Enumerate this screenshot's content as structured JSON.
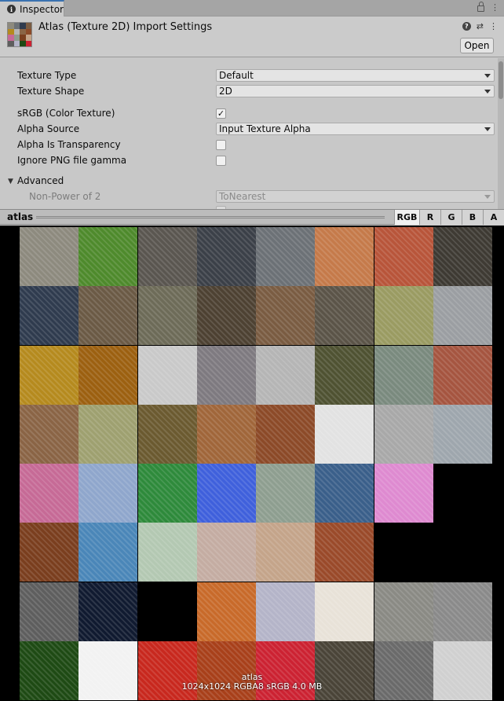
{
  "tab": {
    "label": "Inspector"
  },
  "header": {
    "title": "Atlas (Texture 2D) Import Settings",
    "open_label": "Open"
  },
  "props": {
    "texture_type": {
      "label": "Texture Type",
      "value": "Default"
    },
    "texture_shape": {
      "label": "Texture Shape",
      "value": "2D"
    },
    "srgb": {
      "label": "sRGB (Color Texture)",
      "checked": "✓"
    },
    "alpha_source": {
      "label": "Alpha Source",
      "value": "Input Texture Alpha"
    },
    "alpha_is_transparency": {
      "label": "Alpha Is Transparency"
    },
    "ignore_png_gamma": {
      "label": "Ignore PNG file gamma"
    },
    "advanced": {
      "label": "Advanced"
    },
    "non_power_of_2": {
      "label": "Non-Power of 2",
      "value": "ToNearest"
    }
  },
  "preview": {
    "name": "atlas",
    "channels": [
      "RGB",
      "R",
      "G",
      "B",
      "A"
    ],
    "caption_name": "atlas",
    "caption_info": "1024x1024  RGBA8 sRGB   4.0 MB"
  },
  "atlas_tiles": [
    [
      "#8d8a7e",
      "#4e8a2c",
      "#5a5650",
      "#3b4048",
      "#6c7176",
      "#c57a4a",
      "#b8553a",
      "#3e3a33"
    ],
    [
      "#2f3b4e",
      "#6b5a45",
      "#6d6b58",
      "#4d4132",
      "#7a5c42",
      "#5b5448",
      "#9a9b62",
      "#9b9ea2"
    ],
    [
      "#b58a1e",
      "#9c6010",
      "#c9c9c9",
      "#7e7a80",
      "#b5b5b5",
      "#4f5232",
      "#7a8a7e",
      "#a55540"
    ],
    [
      "#8a6445",
      "#9ea070",
      "#6b5a30",
      "#a0663a",
      "#8c4a28",
      "#e2e2e2",
      "#a8a8a8",
      "#9ea6ad"
    ],
    [
      "#c66a96",
      "#8fa6cc",
      "#2e8a3b",
      "#3f60dc",
      "#8e9e90",
      "#3a5f8a",
      "#de8ad0",
      "#000000"
    ],
    [
      "#7a3e1e",
      "#4a86b8",
      "#b3c8b2",
      "#c4aca2",
      "#c4a48a",
      "#9a4a2a",
      "#000000",
      "#000000"
    ],
    [
      "#5e5e5e",
      "#101a30",
      "#000000",
      "#c86a2a",
      "#b4b4c8",
      "#e8e2d8",
      "#8a8a84",
      "#8a8a8a"
    ],
    [
      "#1e4a14",
      "#f2f2f2",
      "#c8281e",
      "#a8401a",
      "#cc2232",
      "#4a4438",
      "#6a6a6a",
      "#d0d0d0"
    ]
  ]
}
